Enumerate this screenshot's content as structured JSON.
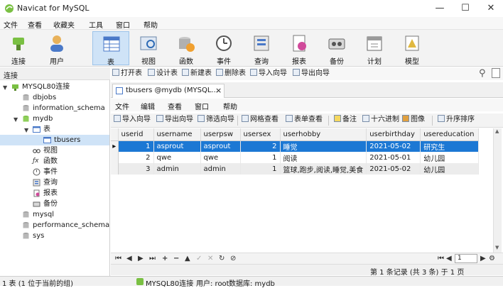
{
  "window": {
    "title": "Navicat for MySQL"
  },
  "menu": [
    "文件",
    "查看",
    "收藏夹",
    "工具",
    "窗口",
    "帮助"
  ],
  "toolbar": [
    {
      "label": "连接",
      "icon": "connection-icon"
    },
    {
      "label": "用户",
      "icon": "user-icon"
    },
    {
      "label": "表",
      "icon": "table-icon",
      "active": true
    },
    {
      "label": "视图",
      "icon": "view-icon"
    },
    {
      "label": "函数",
      "icon": "function-icon"
    },
    {
      "label": "事件",
      "icon": "event-icon"
    },
    {
      "label": "查询",
      "icon": "query-icon"
    },
    {
      "label": "报表",
      "icon": "report-icon"
    },
    {
      "label": "备份",
      "icon": "backup-icon"
    },
    {
      "label": "计划",
      "icon": "schedule-icon"
    },
    {
      "label": "模型",
      "icon": "model-icon"
    }
  ],
  "left_panel": {
    "header": "连接",
    "tree": [
      {
        "label": "MYSQL80连接",
        "level": 0,
        "expand": "▾",
        "icon": "connection-icon"
      },
      {
        "label": "dbjobs",
        "level": 1,
        "icon": "database-icon"
      },
      {
        "label": "information_schema",
        "level": 1,
        "icon": "database-icon"
      },
      {
        "label": "mydb",
        "level": 1,
        "expand": "▾",
        "icon": "database-icon"
      },
      {
        "label": "表",
        "level": 2,
        "expand": "▾",
        "icon": "tables-folder-icon"
      },
      {
        "label": "tbusers",
        "level": 3,
        "icon": "table-icon",
        "selected": true
      },
      {
        "label": "视图",
        "level": 2,
        "icon": "view-icon"
      },
      {
        "label": "函数",
        "level": 2,
        "icon": "function-icon"
      },
      {
        "label": "事件",
        "level": 2,
        "icon": "event-icon"
      },
      {
        "label": "查询",
        "level": 2,
        "icon": "query-icon"
      },
      {
        "label": "报表",
        "level": 2,
        "icon": "report-icon"
      },
      {
        "label": "备份",
        "level": 2,
        "icon": "backup-icon"
      },
      {
        "label": "mysql",
        "level": 1,
        "icon": "database-icon"
      },
      {
        "label": "performance_schema",
        "level": 1,
        "icon": "database-icon"
      },
      {
        "label": "sys",
        "level": 1,
        "icon": "database-icon"
      }
    ]
  },
  "object_toolbar": [
    "打开表",
    "设计表",
    "新建表",
    "删除表",
    "导入向导",
    "导出向导"
  ],
  "tab": {
    "label": "tbusers @mydb (MYSQL...",
    "close": "×"
  },
  "inner_menu": [
    "文件",
    "编辑",
    "查看",
    "窗口",
    "帮助"
  ],
  "grid_toolbar": [
    "导入向导",
    "导出向导",
    "筛选向导",
    "网格查看",
    "表单查看",
    "备注",
    "十六进制",
    "图像",
    "升序排序"
  ],
  "grid": {
    "columns": [
      "userid",
      "username",
      "userpsw",
      "usersex",
      "userhobby",
      "userbirthday",
      "usereducation"
    ],
    "rows": [
      [
        "1",
        "asprout",
        "asprout",
        "2",
        "睡觉",
        "2021-05-02",
        "研究生"
      ],
      [
        "2",
        "qwe",
        "qwe",
        "1",
        "阅读",
        "2021-05-01",
        "幼儿园"
      ],
      [
        "3",
        "admin",
        "admin",
        "1",
        "篮球,跑步,阅读,睡觉,美食",
        "2021-05-02",
        "幼儿园"
      ]
    ],
    "selected_row": 0
  },
  "navbar": {
    "page": "1",
    "buttons": [
      "⏮",
      "◀",
      "▶",
      "⏭",
      "+",
      "−",
      "▲",
      "✓",
      "✕",
      "↻",
      "⊘"
    ]
  },
  "record_status": "第 1 条记录 (共 3 条) 于 1 页",
  "statusbar": {
    "left": "1 表 (1 位于当前的组)",
    "connection": "MYSQL80连接",
    "user": "用户: root",
    "database": "数据库: mydb"
  }
}
